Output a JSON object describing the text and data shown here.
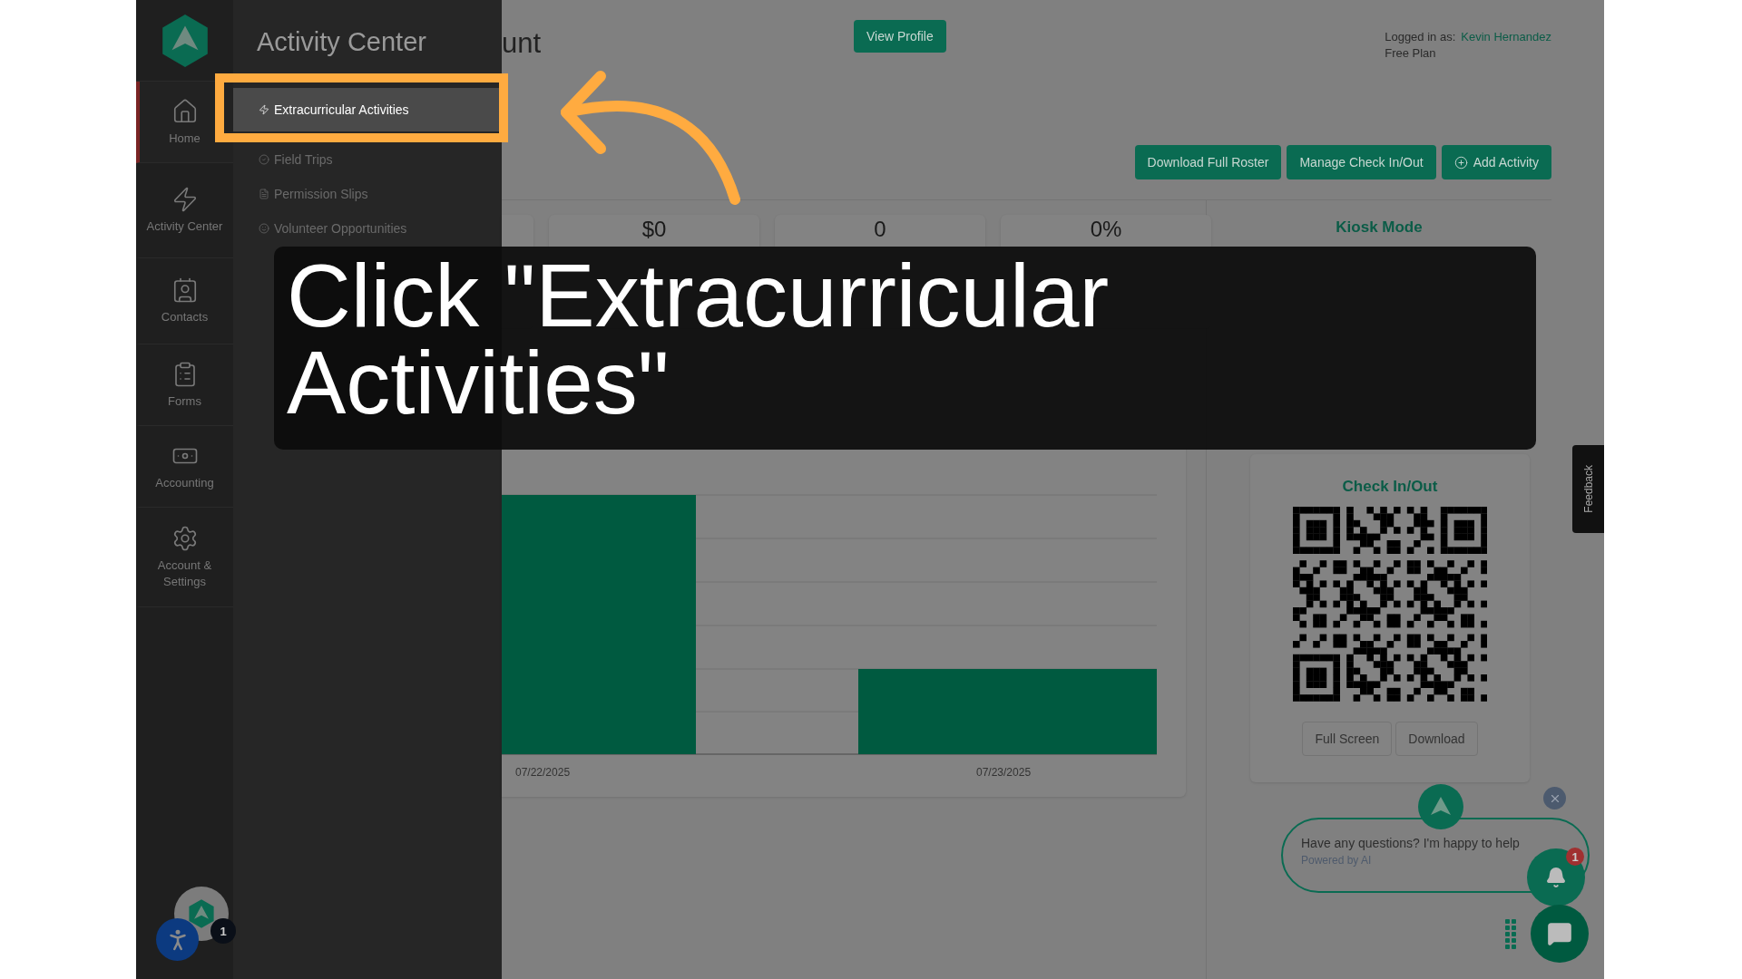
{
  "nav": {
    "items": [
      {
        "label": "Home",
        "selected": true
      },
      {
        "label": "Activity Center",
        "selected": false
      },
      {
        "label": "Contacts",
        "selected": false
      },
      {
        "label": "Forms",
        "selected": false
      },
      {
        "label": "Accounting",
        "selected": false
      },
      {
        "label": "Account & Settings",
        "selected": false
      }
    ]
  },
  "flyout": {
    "title": "Activity Center",
    "items": [
      {
        "label": "Extracurricular Activities",
        "selected": true
      },
      {
        "label": "Field Trips",
        "selected": false
      },
      {
        "label": "Permission Slips",
        "selected": false
      },
      {
        "label": "Volunteer Opportunities",
        "selected": false
      }
    ]
  },
  "header": {
    "title": "unt",
    "view_profile": "View Profile",
    "logged_in_label": "Logged in as:",
    "user": "Kevin Hernandez",
    "plan": "Free Plan"
  },
  "toolbar": [
    "Download Full Roster",
    "Manage Check In/Out",
    "Add Activity"
  ],
  "stats": [
    "$0",
    "0",
    "0%"
  ],
  "kiosk": {
    "title": "Kiosk Mode"
  },
  "chart": {
    "x_labels": [
      "07/22/2025",
      "07/23/2025"
    ]
  },
  "checkin": {
    "title": "Check In/Out",
    "buttons": [
      "Full Screen",
      "Download"
    ]
  },
  "feedback": "Feedback",
  "chat": {
    "message": "Have any questions? I'm happy to help",
    "powered": "Powered by AI",
    "badge": "1"
  },
  "avatar_badge": "1",
  "caption": "Click \"Extracurricular Activities\""
}
